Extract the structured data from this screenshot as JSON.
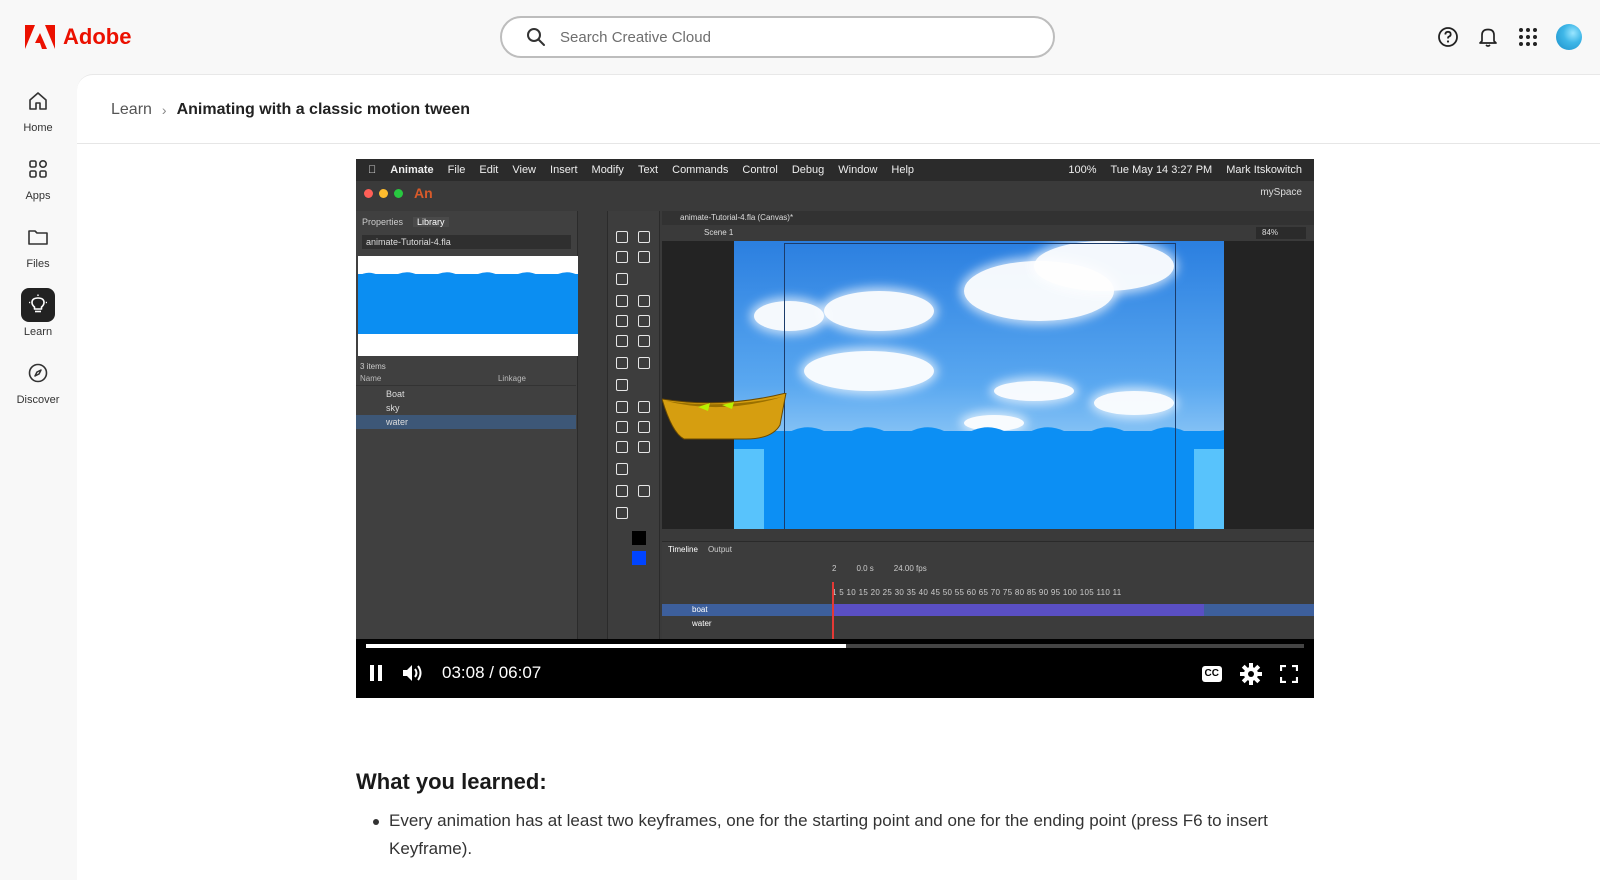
{
  "header": {
    "brand": "Adobe",
    "search_placeholder": "Search Creative Cloud"
  },
  "rail": {
    "items": [
      {
        "label": "Home",
        "icon": "home-icon"
      },
      {
        "label": "Apps",
        "icon": "apps-icon"
      },
      {
        "label": "Files",
        "icon": "folder-icon"
      },
      {
        "label": "Learn",
        "icon": "lightbulb-icon",
        "active": true
      },
      {
        "label": "Discover",
        "icon": "compass-icon"
      }
    ]
  },
  "breadcrumb": {
    "parent": "Learn",
    "current": "Animating with a classic motion tween"
  },
  "video": {
    "time": "03:08 / 06:07",
    "progress": 0.512,
    "screen": {
      "menubar": [
        "Animate",
        "File",
        "Edit",
        "View",
        "Insert",
        "Modify",
        "Text",
        "Commands",
        "Control",
        "Debug",
        "Window",
        "Help"
      ],
      "battery": "100%",
      "datetime": "Tue May 14  3:27 PM",
      "user": "Mark Itskowitch",
      "app_logo": "An",
      "workspace": "mySpace",
      "panel_tabs": [
        "Properties",
        "Library"
      ],
      "library_file": "animate-Tutorial-4.fla",
      "library_count": "3 items",
      "library_columns": [
        "Name",
        "Linkage"
      ],
      "library_items": [
        "Boat",
        "sky",
        "water"
      ],
      "doc_tab": "animate-Tutorial-4.fla (Canvas)*",
      "scene": "Scene 1",
      "zoom": "84%",
      "timeline_tabs": [
        "Timeline",
        "Output"
      ],
      "frame": "2",
      "seconds": "0.0 s",
      "fps": "24.00 fps",
      "ruler": "1   5   10   15   20   25   30   35   40   45   50   55   60   65   70   75   80   85   90   95   100  105  110  11",
      "layers": [
        "boat",
        "water"
      ]
    }
  },
  "content": {
    "heading": "What you learned:",
    "bullets": [
      "Every animation has at least two keyframes, one for the starting point and one for the ending point (press F6 to insert Keyframe)."
    ]
  }
}
